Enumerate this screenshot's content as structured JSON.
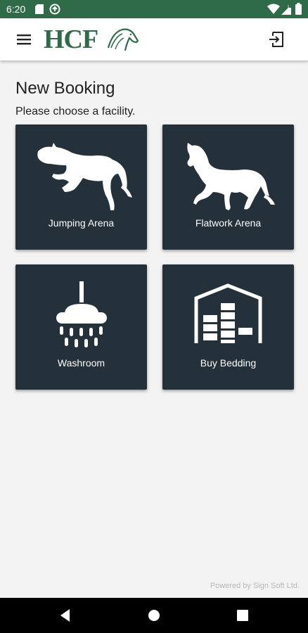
{
  "status_bar": {
    "time": "6:20",
    "left_icons": [
      "sd-card-icon",
      "sync-icon"
    ],
    "right_icons": [
      "wifi-icon",
      "signal-icon",
      "battery-icon"
    ],
    "color": "#2f6b48"
  },
  "app_bar": {
    "logo_text": "HCF",
    "brand_color": "#2f6b48",
    "menu_icon": "hamburger-menu-icon",
    "logout_icon": "logout-icon"
  },
  "page": {
    "title": "New Booking",
    "subtitle": "Please choose a facility."
  },
  "facilities": [
    {
      "label": "Jumping Arena",
      "icon": "jumping-horse-icon"
    },
    {
      "label": "Flatwork Arena",
      "icon": "trotting-horse-icon"
    },
    {
      "label": "Washroom",
      "icon": "shower-icon"
    },
    {
      "label": "Buy Bedding",
      "icon": "bedding-barn-icon"
    }
  ],
  "tile_color": "#24303a",
  "footer": {
    "powered_by": "Powered by Sign Soft Ltd."
  },
  "nav_bar": {
    "icons": [
      "back-icon",
      "home-icon",
      "recents-icon"
    ]
  }
}
